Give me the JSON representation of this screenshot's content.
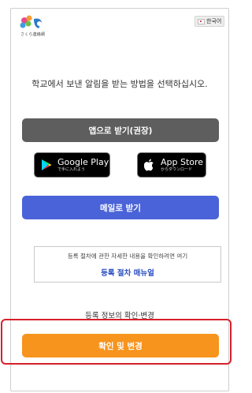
{
  "header": {
    "logo_text": "さくら連絡網",
    "language_label": "한국어"
  },
  "main": {
    "instruction": "학교에서 보낸 알림을 받는 방법을 선택하십시오.",
    "app_button_label": "앱으로 받기(권장)",
    "google_play": {
      "main": "Google Play",
      "sub": "で手に入れよう"
    },
    "app_store": {
      "main": "App Store",
      "sub": "からダウンロード"
    },
    "mail_button_label": "메일로 받기",
    "manual_box": {
      "description": "등록 절차에 관한 자세한 내용을 확인하려면 여기",
      "link_label": "등록 절차 매뉴얼"
    },
    "registration_label": "등록 정보의 확인·변경",
    "check_button_label": "확인 및 변경"
  },
  "colors": {
    "app_button": "#5e5e5e",
    "mail_button": "#4a63d8",
    "check_button": "#f7941d",
    "highlight": "#d6202b",
    "link": "#2a4ec2"
  }
}
